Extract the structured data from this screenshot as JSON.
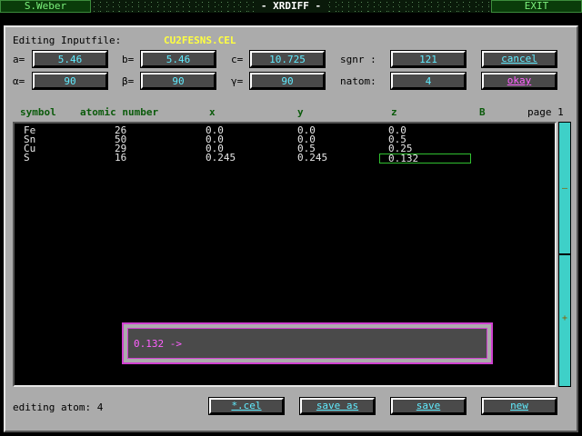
{
  "topbar": {
    "author": "S.Weber",
    "title": "- XRDIFF -",
    "exit": "EXIT"
  },
  "header": {
    "editing_label": "Editing Inputfile:",
    "filename": "CU2FESNS.CEL"
  },
  "params": {
    "a": {
      "label": "a=",
      "value": "5.46"
    },
    "b": {
      "label": "b=",
      "value": "5.46"
    },
    "c": {
      "label": "c=",
      "value": "10.725"
    },
    "sgnr": {
      "label": "sgnr :",
      "value": "121"
    },
    "alpha": {
      "label": "α=",
      "value": "90"
    },
    "beta": {
      "label": "β=",
      "value": "90"
    },
    "gamma": {
      "label": "γ=",
      "value": "90"
    },
    "natom": {
      "label": "natom:",
      "value": "4"
    }
  },
  "buttons": {
    "cancel": "cancel",
    "okay": "okay",
    "cel": "*.cel",
    "save_as": "save as",
    "save": "save",
    "new": "new"
  },
  "table": {
    "headers": {
      "symbol": "symbol",
      "atomic_number": "atomic number",
      "x": "x",
      "y": "y",
      "z": "z",
      "b": "B",
      "page": "page 1"
    },
    "rows": [
      {
        "symbol": "Fe",
        "z_num": "26",
        "x": "0.0",
        "y": "0.0",
        "z": "0.0"
      },
      {
        "symbol": "Sn",
        "z_num": "50",
        "x": "0.0",
        "y": "0.0",
        "z": "0.5"
      },
      {
        "symbol": "Cu",
        "z_num": "29",
        "x": "0.0",
        "y": "0.5",
        "z": "0.25"
      },
      {
        "symbol": "S",
        "z_num": "16",
        "x": "0.245",
        "y": "0.245",
        "z": "0.132"
      }
    ]
  },
  "scrollbar": {
    "up_glyph": "–",
    "down_glyph": "+"
  },
  "input_dialog": {
    "text": "0.132 ->"
  },
  "status": {
    "editing_atom": "editing atom: 4"
  },
  "colors": {
    "panel": "#ababab",
    "field_text": "#60ecff",
    "accent_pink": "#ff60ff",
    "filename": "#ffff40"
  }
}
